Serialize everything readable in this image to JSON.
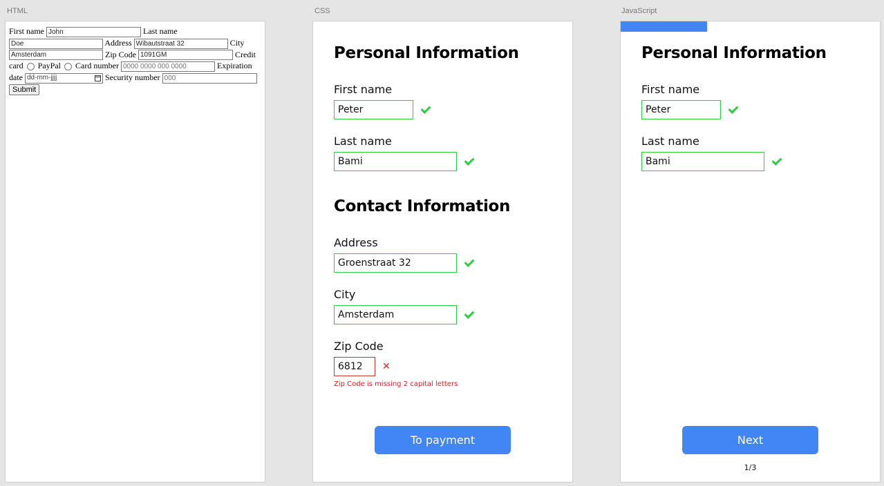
{
  "labels": {
    "html": "HTML",
    "css": "CSS",
    "js": "JavaScript"
  },
  "raw_form": {
    "first_name_label": "First name",
    "first_name_value": "John",
    "last_name_label": "Last name",
    "last_name_value": "Doe",
    "address_label": "Address",
    "address_value": "Wibautstraat 32",
    "city_label": "City",
    "city_value": "Amsterdam",
    "zip_label": "Zip Code",
    "zip_value": "1091GM",
    "credit_card_label": "Credit card",
    "paypal_label": "PayPal",
    "card_number_label": "Card number",
    "card_number_placeholder": "0000 0000 000 0000",
    "expiration_label": "Expiration date",
    "date_placeholder": "dd-mm-jjjj",
    "security_label": "Security number",
    "security_placeholder": "000",
    "submit_label": "Submit"
  },
  "css_form": {
    "personal_title": "Personal Information",
    "first_name_label": "First name",
    "first_name_value": "Peter",
    "last_name_label": "Last name",
    "last_name_value": "Bami",
    "contact_title": "Contact Information",
    "address_label": "Address",
    "address_value": "Groenstraat 32",
    "city_label": "City",
    "city_value": "Amsterdam",
    "zip_label": "Zip Code",
    "zip_value": "6812",
    "zip_error": "Zip Code is missing 2 capital letters",
    "button_label": "To payment"
  },
  "js_form": {
    "progress_fraction": 0.333,
    "personal_title": "Personal Information",
    "first_name_label": "First name",
    "first_name_value": "Peter",
    "last_name_label": "Last name",
    "last_name_value": "Bami",
    "button_label": "Next",
    "pager": "1/3"
  },
  "colors": {
    "accent": "#4285f4",
    "valid": "#2ecc40",
    "error": "#d22222"
  },
  "icons": {
    "valid": "check-icon",
    "invalid": "cross-icon"
  }
}
